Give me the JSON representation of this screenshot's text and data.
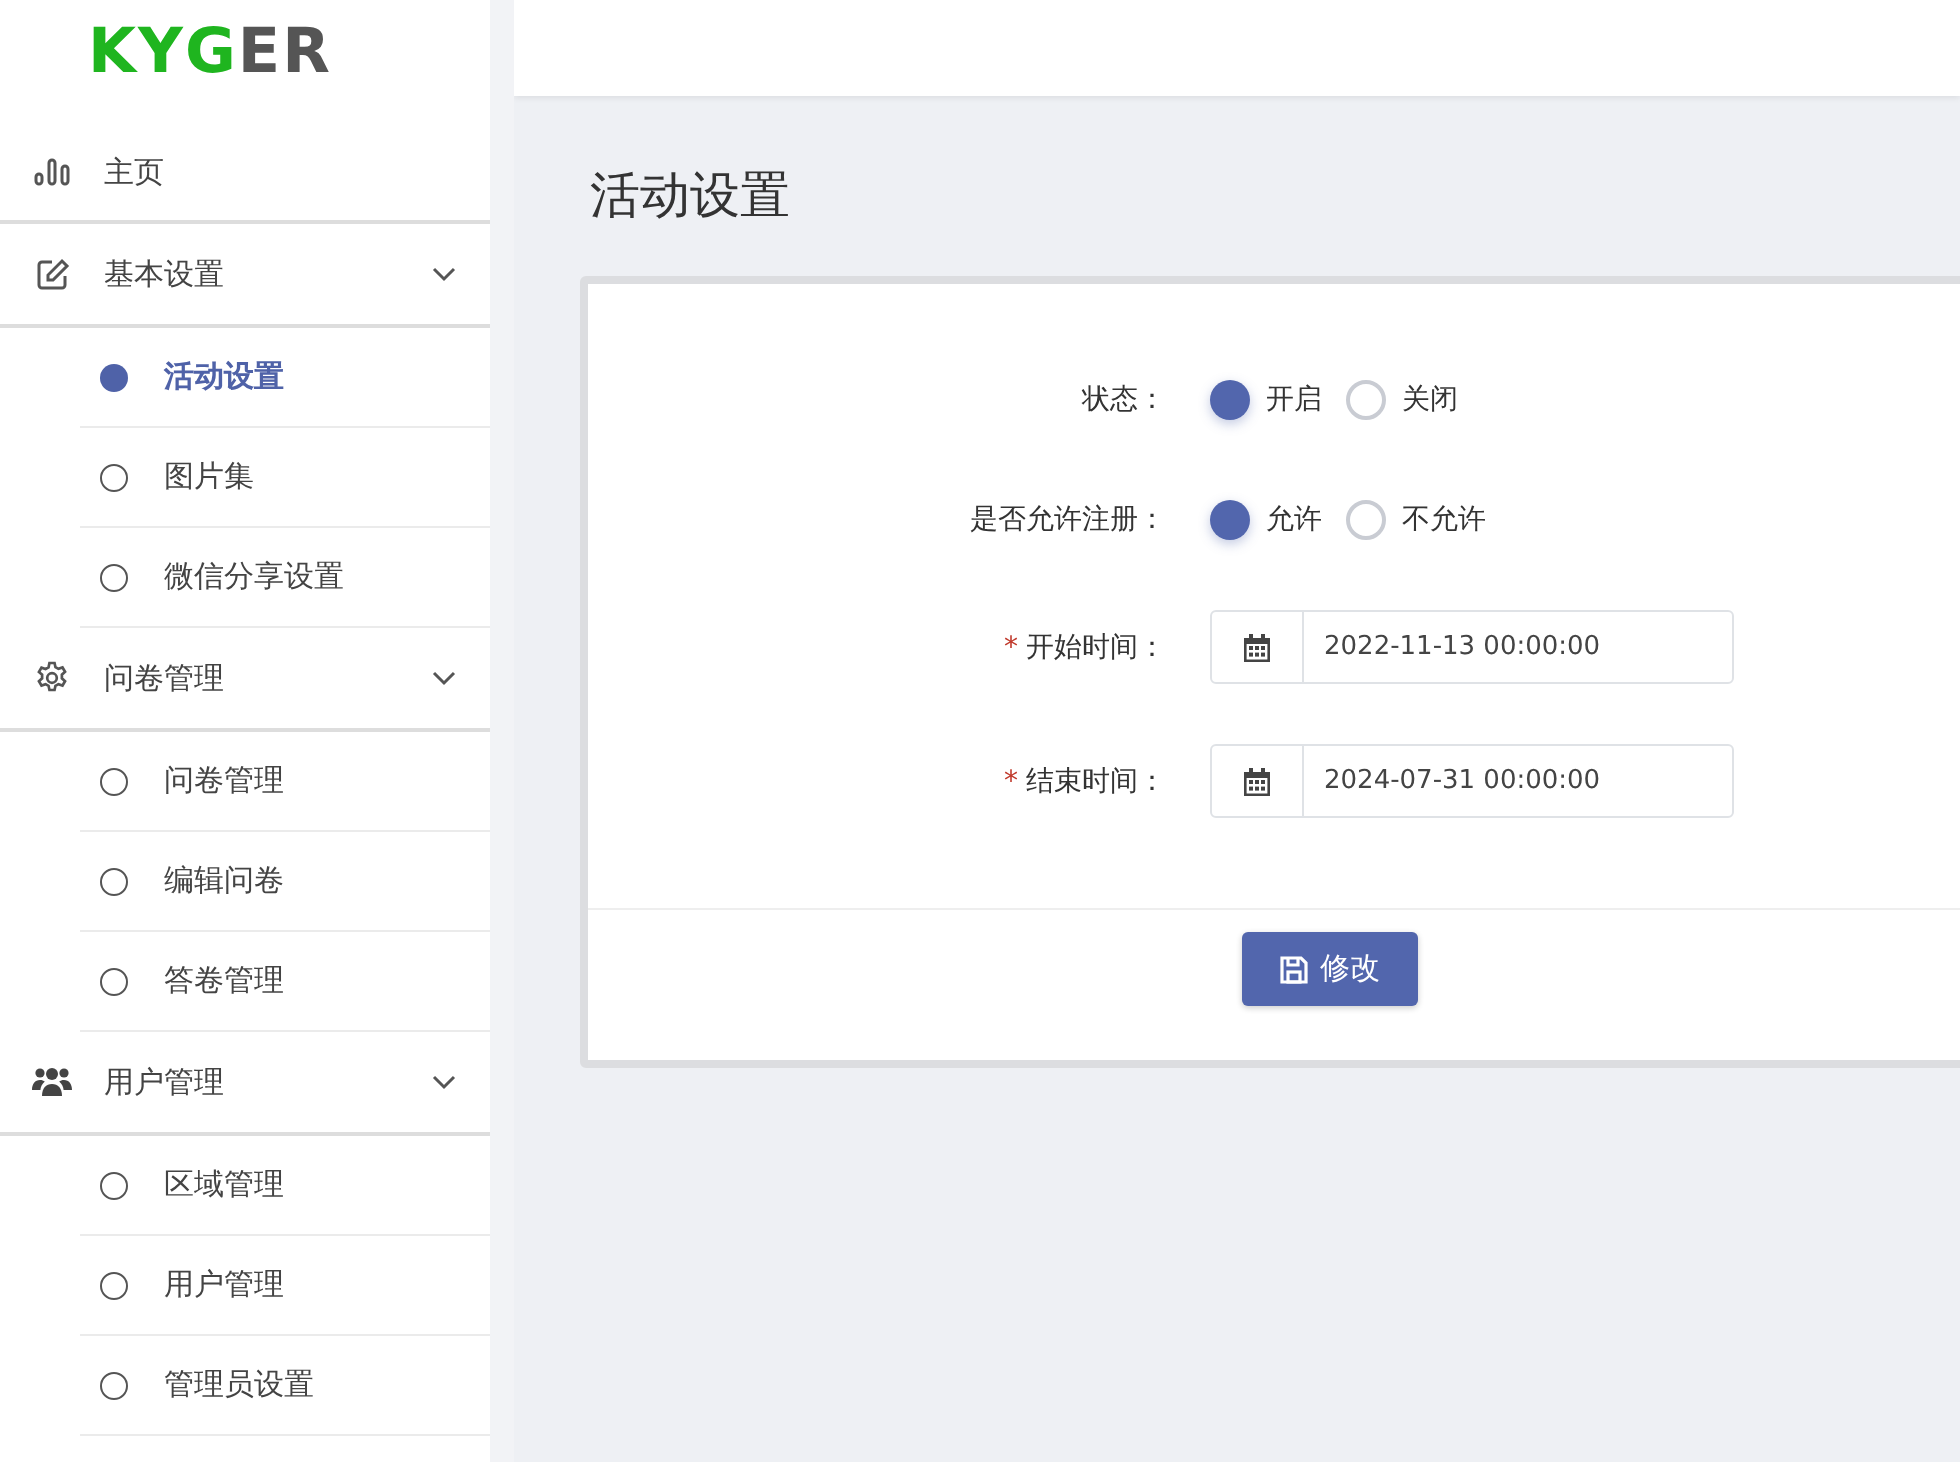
{
  "logo": {
    "primary": "KYG",
    "secondary": "ER"
  },
  "nav": [
    {
      "kind": "link",
      "label": "主页"
    },
    {
      "kind": "group",
      "label": "基本设置",
      "expanded": true,
      "children": [
        {
          "label": "活动设置",
          "selected": true
        },
        {
          "label": "图片集",
          "selected": false
        },
        {
          "label": "微信分享设置",
          "selected": false
        }
      ]
    },
    {
      "kind": "group",
      "label": "问卷管理",
      "expanded": true,
      "children": [
        {
          "label": "问卷管理",
          "selected": false
        },
        {
          "label": "编辑问卷",
          "selected": false
        },
        {
          "label": "答卷管理",
          "selected": false
        }
      ]
    },
    {
      "kind": "group",
      "label": "用户管理",
      "expanded": true,
      "children": [
        {
          "label": "区域管理",
          "selected": false
        },
        {
          "label": "用户管理",
          "selected": false
        },
        {
          "label": "管理员设置",
          "selected": false
        }
      ]
    }
  ],
  "page_title": "活动设置",
  "form": {
    "fields": [
      {
        "kind": "radio",
        "label": "状态：",
        "options": [
          {
            "label": "开启",
            "selected": true
          },
          {
            "label": "关闭",
            "selected": false
          }
        ]
      },
      {
        "kind": "radio",
        "label": "是否允许注册：",
        "options": [
          {
            "label": "允许",
            "selected": true
          },
          {
            "label": "不允许",
            "selected": false
          }
        ]
      },
      {
        "kind": "date",
        "marker": "*",
        "label": "开始时间：",
        "value": "2022-11-13 00:00:00"
      },
      {
        "kind": "date",
        "marker": "*",
        "label": "结束时间：",
        "value": "2024-07-31 00:00:00"
      }
    ],
    "submit": "修改"
  }
}
